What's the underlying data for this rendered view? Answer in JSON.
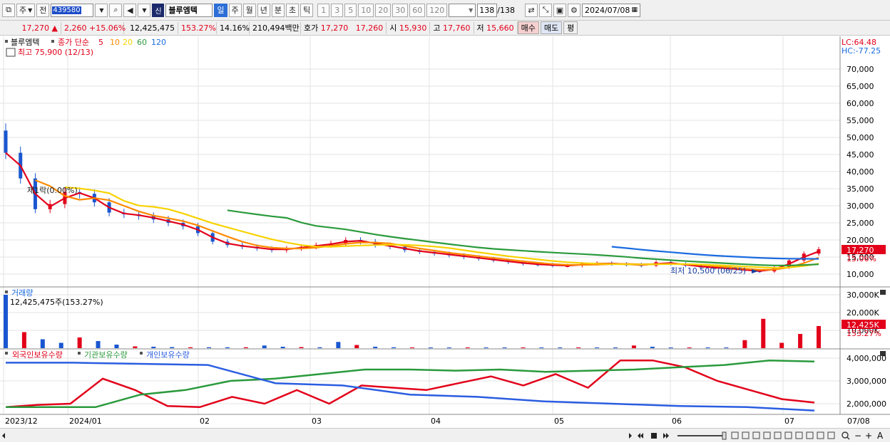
{
  "toolbar": {
    "period_select": "주",
    "prev_label": "전",
    "code": "439580",
    "new_badge": "신",
    "stock_name": "블루엠텍",
    "periods": [
      "일",
      "주",
      "월",
      "년",
      "분",
      "초",
      "틱"
    ],
    "active_period": "일",
    "intervals": [
      "1",
      "3",
      "5",
      "10",
      "20",
      "30",
      "60",
      "120"
    ],
    "count": "138",
    "count_total": "/138",
    "date": "2024/07/08"
  },
  "quote": {
    "price": "17,270",
    "arrow": "▲",
    "change": "2,260",
    "change_pct": "+15.06%",
    "volume": "12,425,475",
    "volume_pct": "153.27%",
    "turnover": "14.16%",
    "amount": "210,494백만",
    "hoga_label": "호가",
    "ask": "17,270",
    "bid": "17,260",
    "open_label": "시",
    "open": "15,930",
    "high_label": "고",
    "high": "17,760",
    "low_label": "저",
    "low": "15,660",
    "buy_label": "매수",
    "sell_label": "매도",
    "eval_label": "평"
  },
  "price_panel": {
    "legend_name": "블루엠텍",
    "legend_ma": "종가 단순",
    "ma_periods": [
      "5",
      "10",
      "20",
      "60",
      "120"
    ],
    "ma_colors": [
      "#e2001a",
      "#ff8a00",
      "#f7d200",
      "#2a9a3c",
      "#1a6be0"
    ],
    "high_note": "최고 75,900 (12/13)",
    "low_note": "최저 10,500 (06/25)",
    "event_note": "제1락(0.00%)",
    "lc": "LC:64.48",
    "hc": "HC:-77.25",
    "current_price": "17,270",
    "current_pct": "15.06%",
    "axis_labels": [
      "70,000",
      "65,000",
      "60,000",
      "55,000",
      "50,000",
      "45,000",
      "40,000",
      "35,000",
      "30,000",
      "25,000",
      "20,000",
      "15,000",
      "10,000"
    ]
  },
  "volume_panel": {
    "title": "거래량",
    "value": "12,425,475주(153.27%)",
    "axis_labels": [
      "30,000K",
      "20,000K",
      "10,000K"
    ],
    "current_value": "12,425K",
    "current_pct": "153.27%"
  },
  "holdings_panel": {
    "legends": [
      "외국인보유수량",
      "기관보유수량",
      "개인보유수량"
    ],
    "colors": [
      "#e2001a",
      "#2a9a3c",
      "#2a5de0"
    ],
    "axis_labels": [
      "4,000,000",
      "3,000,000",
      "2,000,000"
    ]
  },
  "x_axis": {
    "labels": [
      "2023/12",
      "2024/01",
      "02",
      "03",
      "04",
      "05",
      "06",
      "07"
    ],
    "right_label": "07/08"
  },
  "chart_data": {
    "type": "candlestick",
    "ylim": [
      8000,
      76000
    ],
    "candles_approx_close": [
      45500,
      38000,
      29000,
      30500,
      34000,
      33500,
      31000,
      28000,
      27500,
      27000,
      26000,
      25000,
      24000,
      22000,
      19500,
      18500,
      18000,
      17500,
      17000,
      17500,
      18000,
      18500,
      19000,
      20000,
      19500,
      18500,
      18000,
      17000,
      16500,
      16000,
      15500,
      15000,
      14500,
      14000,
      13500,
      13000,
      12800,
      12500,
      12500,
      13000,
      13200,
      13000,
      12800,
      12500,
      13500,
      13000,
      12500,
      12000,
      11800,
      11500,
      11000,
      10800,
      12000,
      14000,
      16000,
      17270
    ],
    "volume_bars_k": [
      30000,
      9000,
      5000,
      3000,
      6000,
      4000,
      2000,
      1000,
      800,
      600,
      500,
      500,
      500,
      500,
      1500,
      800,
      600,
      500,
      3500,
      1800,
      800,
      500,
      400,
      400,
      400,
      400,
      400,
      400,
      400,
      400,
      400,
      400,
      400,
      400,
      1500,
      800,
      400,
      400,
      400,
      400,
      4500,
      16500,
      3000,
      8000,
      12425
    ],
    "foreign_holdings": [
      1850000,
      1950000,
      2000000,
      3100000,
      2600000,
      1900000,
      1850000,
      2300000,
      2000000,
      2600000,
      2000000,
      2800000,
      2700000,
      2600000,
      2900000,
      3200000,
      2800000,
      3300000,
      2700000,
      3900000,
      3900000,
      3600000,
      3000000,
      2600000,
      2200000,
      2050000
    ],
    "institution_holdings": [
      1850000,
      1850000,
      1850000,
      2400000,
      2600000,
      3000000,
      3100000,
      3300000,
      3500000,
      3500000,
      3450000,
      3500000,
      3400000,
      3450000,
      3500000,
      3600000,
      3700000,
      3900000,
      3850000
    ],
    "individual_holdings": [
      3800000,
      3800000,
      3750000,
      3700000,
      2900000,
      2800000,
      2400000,
      2300000,
      2100000,
      2000000,
      1900000,
      1850000,
      1700000
    ]
  },
  "bottom": {
    "minus": "−",
    "plus": "+",
    "a": "A"
  }
}
